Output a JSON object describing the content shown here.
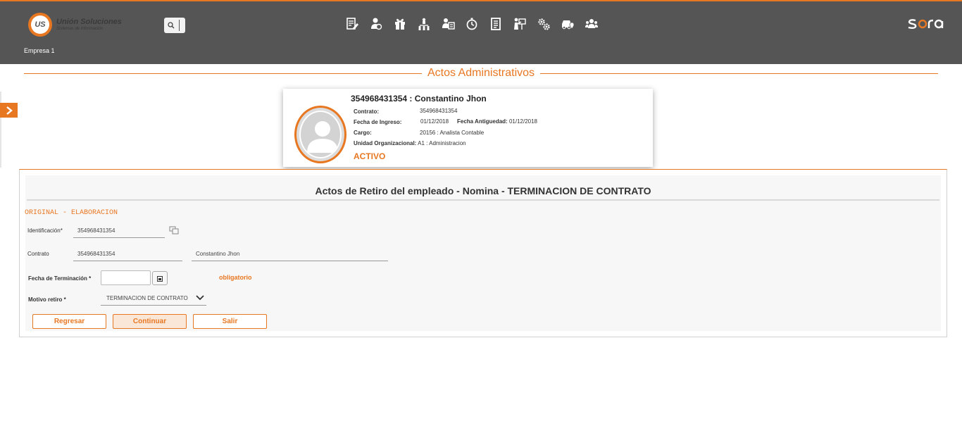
{
  "header": {
    "logo_mark": "US",
    "logo_title": "Unión Soluciones",
    "logo_subtitle": "Sistemas de Información",
    "company": "Empresa 1",
    "brand": "sora",
    "accent_color": "#e87722",
    "bar_color": "#555555",
    "nav_icons": [
      "document-edit-icon",
      "employee-money-icon",
      "gift-icon",
      "org-chart-icon",
      "employee-card-icon",
      "stopwatch-icon",
      "report-icon",
      "training-icon",
      "settings-gears-icon",
      "vehicle-location-icon",
      "team-icon"
    ]
  },
  "page": {
    "title": "Actos Administrativos"
  },
  "employee": {
    "heading": "354968431354 : Constantino Jhon",
    "contrato_label": "Contrato:",
    "contrato_value": "354968431354",
    "ingreso_label": "Fecha de Ingreso:",
    "ingreso_value": "01/12/2018",
    "antiguedad_label": "Fecha Antiguedad:",
    "antiguedad_value": "01/12/2018",
    "cargo_label": "Cargo:",
    "cargo_value": "20156 : Analista Contable",
    "unidad_label": "Unidad Organizacional:",
    "unidad_value": "A1 : Administracion",
    "status": "ACTIVO"
  },
  "form": {
    "title": "Actos de Retiro del empleado - Nomina - TERMINACION DE CONTRATO",
    "state": "ORIGINAL - ELABORACION",
    "identificacion_label": "Identificación*",
    "identificacion_value": "354968431354",
    "contrato_label": "Contrato",
    "contrato_value": "354968431354",
    "contrato_name": "Constantino Jhon",
    "fecha_label": "Fecha de Terminación *",
    "fecha_value": "",
    "required_note": "obligatorio",
    "motivo_label": "Motivo retiro *",
    "motivo_value": "TERMINACION DE CONTRATO"
  },
  "buttons": {
    "back": "Regresar",
    "continue": "Continuar",
    "exit": "Salir"
  }
}
